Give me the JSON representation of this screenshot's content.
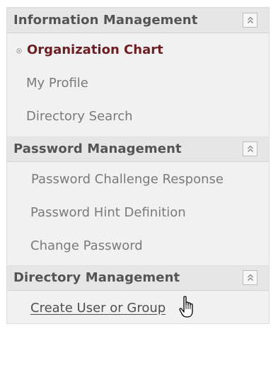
{
  "sidebar": {
    "sections": [
      {
        "title": "Information Management",
        "items": [
          {
            "label": "Organization Chart",
            "selected": true
          },
          {
            "label": "My Profile"
          },
          {
            "label": "Directory Search"
          }
        ]
      },
      {
        "title": "Password Management",
        "items": [
          {
            "label": "Password Challenge Response"
          },
          {
            "label": "Password Hint Definition"
          },
          {
            "label": "Change Password"
          }
        ]
      },
      {
        "title": "Directory Management",
        "items": [
          {
            "label": "Create User or Group",
            "hovered": true
          }
        ]
      }
    ],
    "collapse_icon": "double-chevron-up-icon",
    "selected_bullet_icon": "radio-dot-icon"
  },
  "pointer": {
    "icon": "hand-pointer-icon"
  },
  "colors": {
    "panel_bg": "#f1f1f1",
    "header_bg": "#e6e6e6",
    "header_text": "#545454",
    "item_text": "#7a7a7a",
    "selected_text": "#6b1e23"
  }
}
